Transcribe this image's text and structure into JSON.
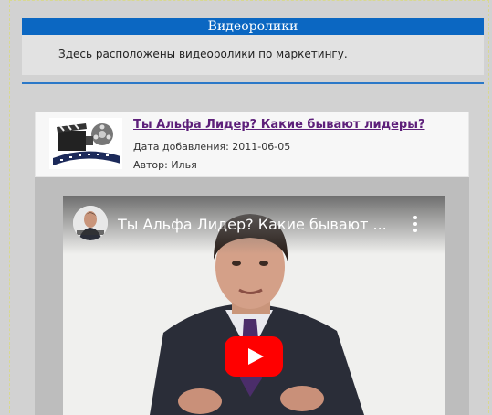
{
  "header": {
    "title": "Видеоролики"
  },
  "intro": {
    "text": "Здесь расположены видеоролики по маркетингу."
  },
  "video": {
    "title": "Ты Альфа Лидер? Какие бывают лидеры?",
    "date_added": "Дата добавления: 2011-06-05",
    "author": "Автор: Илья",
    "thumbnail_icon": "film-camera-icon"
  },
  "player": {
    "title": "Ты Альфа Лидер? Какие бывают ...",
    "menu_icon": "kebab-menu-icon",
    "play_icon": "play-icon",
    "colors": {
      "play_button": "#ff0000",
      "title_bar": "#0b67c2",
      "link": "#5d1f7a"
    }
  }
}
